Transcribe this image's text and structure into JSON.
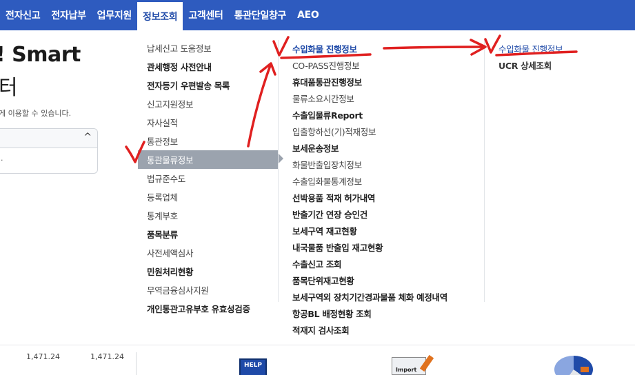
{
  "topnav": {
    "items": [
      "전자신고",
      "전자납부",
      "업무지원",
      "정보조회",
      "고객센터",
      "통관단일창구",
      "AEO"
    ],
    "active_index": 3
  },
  "background": {
    "hero_title": "! Smart",
    "hero_sub": "터",
    "hero_desc": "게 이용할 수 있습니다.",
    "panel_chevron": "^",
    "panel_mark": "."
  },
  "menu": {
    "col1": [
      {
        "label": "납세신고 도움정보",
        "bold": false
      },
      {
        "label": "관세행정 사전안내",
        "bold": true
      },
      {
        "label": "전자등기 우편발송 목록",
        "bold": true
      },
      {
        "label": "신고지원정보",
        "bold": false
      },
      {
        "label": "자사실적",
        "bold": false
      },
      {
        "label": "통관정보",
        "bold": false
      },
      {
        "label": "통관물류정보",
        "bold": false,
        "selected": true
      },
      {
        "label": "법규준수도",
        "bold": false
      },
      {
        "label": "등록업체",
        "bold": false
      },
      {
        "label": "통계부호",
        "bold": false
      },
      {
        "label": "품목분류",
        "bold": true
      },
      {
        "label": "사전세액심사",
        "bold": false
      },
      {
        "label": "민원처리현황",
        "bold": true
      },
      {
        "label": "무역금융심사지원",
        "bold": false
      },
      {
        "label": "개인통관고유부호 유효성검증",
        "bold": true
      }
    ],
    "col2": [
      {
        "label": "수입화물 진행정보",
        "bold": true,
        "active": true
      },
      {
        "label": "CO-PASS진행정보",
        "bold": false
      },
      {
        "label": "휴대품통관진행정보",
        "bold": true
      },
      {
        "label": "물류소요시간정보",
        "bold": false
      },
      {
        "label": "수출입물류Report",
        "bold": true
      },
      {
        "label": "입출항하선(기)적재정보",
        "bold": false
      },
      {
        "label": "보세운송정보",
        "bold": true
      },
      {
        "label": "화물반출입장치정보",
        "bold": false
      },
      {
        "label": "수출입화물통계정보",
        "bold": false
      },
      {
        "label": "선박용품 적재 허가내역",
        "bold": true
      },
      {
        "label": "반출기간 연장 승인건",
        "bold": true
      },
      {
        "label": "보세구역 재고현황",
        "bold": true
      },
      {
        "label": "내국물품 반출입 재고현황",
        "bold": true
      },
      {
        "label": "수출신고 조회",
        "bold": true
      },
      {
        "label": "품목단위재고현황",
        "bold": true
      },
      {
        "label": "보세구역외 장치기간경과물품 체화 예정내역",
        "bold": true
      },
      {
        "label": "항공BL 배정현황 조회",
        "bold": true
      },
      {
        "label": "적재지 검사조회",
        "bold": true
      }
    ],
    "col3": [
      {
        "label": "수입화물 진행정보",
        "bold": false,
        "highlight": true
      },
      {
        "label": "UCR 상세조회",
        "bold": true
      }
    ]
  },
  "bottom": {
    "num_left": "1,471.24",
    "num_right": "1,471.24",
    "help_label": "HELP",
    "import_label": "Import"
  },
  "colors": {
    "nav_bg": "#2e5bbf",
    "active_text": "#1f4aa8",
    "selected_bg": "#9ba3ae",
    "annotation": "#e02020"
  }
}
